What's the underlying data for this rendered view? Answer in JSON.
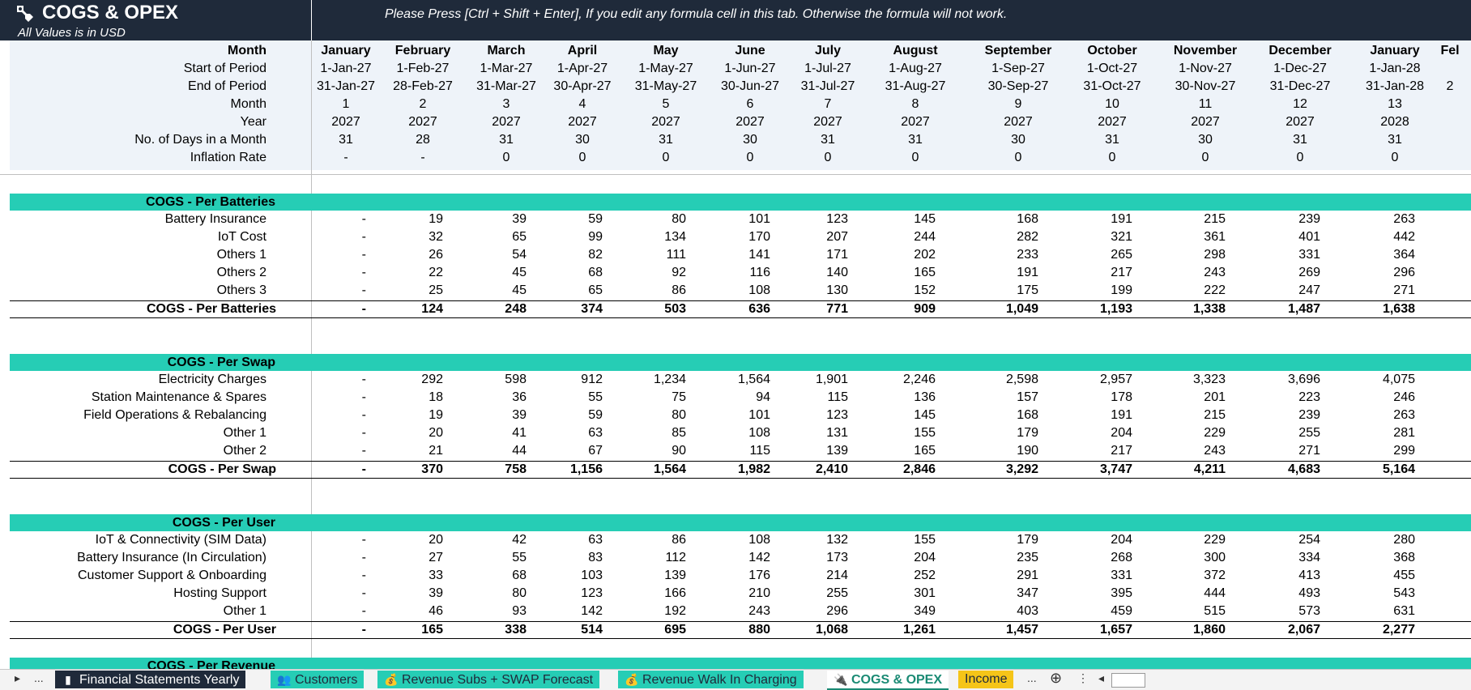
{
  "title": "COGS & OPEX",
  "subtitle": "All Values is in USD",
  "note": "Please Press [Ctrl + Shift + Enter], If you edit any formula cell in this tab. Otherwise the formula will not work.",
  "colors": {
    "dark": "#1f2a3a",
    "section": "#26cdb5",
    "header_bg": "#eef3f9"
  },
  "columns": [
    "January",
    "February",
    "March",
    "April",
    "May",
    "June",
    "July",
    "August",
    "September",
    "October",
    "November",
    "December",
    "January",
    "Fel"
  ],
  "header_rows": [
    {
      "label": "Month",
      "cells": [
        "January",
        "February",
        "March",
        "April",
        "May",
        "June",
        "July",
        "August",
        "September",
        "October",
        "November",
        "December",
        "January",
        "Fel"
      ]
    },
    {
      "label": "Start of Period",
      "cells": [
        "1-Jan-27",
        "1-Feb-27",
        "1-Mar-27",
        "1-Apr-27",
        "1-May-27",
        "1-Jun-27",
        "1-Jul-27",
        "1-Aug-27",
        "1-Sep-27",
        "1-Oct-27",
        "1-Nov-27",
        "1-Dec-27",
        "1-Jan-28",
        ""
      ]
    },
    {
      "label": "End of Period",
      "cells": [
        "31-Jan-27",
        "28-Feb-27",
        "31-Mar-27",
        "30-Apr-27",
        "31-May-27",
        "30-Jun-27",
        "31-Jul-27",
        "31-Aug-27",
        "30-Sep-27",
        "31-Oct-27",
        "30-Nov-27",
        "31-Dec-27",
        "31-Jan-28",
        "2"
      ]
    },
    {
      "label": "Month",
      "cells": [
        "1",
        "2",
        "3",
        "4",
        "5",
        "6",
        "7",
        "8",
        "9",
        "10",
        "11",
        "12",
        "13",
        ""
      ]
    },
    {
      "label": "Year",
      "cells": [
        "2027",
        "2027",
        "2027",
        "2027",
        "2027",
        "2027",
        "2027",
        "2027",
        "2027",
        "2027",
        "2027",
        "2027",
        "2028",
        ""
      ]
    },
    {
      "label": "No. of Days in a Month",
      "cells": [
        "31",
        "28",
        "31",
        "30",
        "31",
        "30",
        "31",
        "31",
        "30",
        "31",
        "30",
        "31",
        "31",
        ""
      ]
    },
    {
      "label": "Inflation Rate",
      "cells": [
        "-",
        "-",
        "0",
        "0",
        "0",
        "0",
        "0",
        "0",
        "0",
        "0",
        "0",
        "0",
        "0",
        ""
      ]
    }
  ],
  "sections": [
    {
      "name": "COGS - Per Batteries",
      "rows": [
        {
          "label": "Battery Insurance",
          "cells": [
            "-",
            "19",
            "39",
            "59",
            "80",
            "101",
            "123",
            "145",
            "168",
            "191",
            "215",
            "239",
            "263"
          ]
        },
        {
          "label": "IoT Cost",
          "cells": [
            "-",
            "32",
            "65",
            "99",
            "134",
            "170",
            "207",
            "244",
            "282",
            "321",
            "361",
            "401",
            "442"
          ]
        },
        {
          "label": "Others 1",
          "cells": [
            "-",
            "26",
            "54",
            "82",
            "111",
            "141",
            "171",
            "202",
            "233",
            "265",
            "298",
            "331",
            "364"
          ]
        },
        {
          "label": "Others 2",
          "cells": [
            "-",
            "22",
            "45",
            "68",
            "92",
            "116",
            "140",
            "165",
            "191",
            "217",
            "243",
            "269",
            "296"
          ]
        },
        {
          "label": "Others 3",
          "cells": [
            "-",
            "25",
            "45",
            "65",
            "86",
            "108",
            "130",
            "152",
            "175",
            "199",
            "222",
            "247",
            "271"
          ]
        }
      ],
      "total": {
        "label": "COGS - Per Batteries",
        "cells": [
          "-",
          "124",
          "248",
          "374",
          "503",
          "636",
          "771",
          "909",
          "1,049",
          "1,193",
          "1,338",
          "1,487",
          "1,638"
        ]
      }
    },
    {
      "name": "COGS - Per Swap",
      "rows": [
        {
          "label": "Electricity Charges",
          "cells": [
            "-",
            "292",
            "598",
            "912",
            "1,234",
            "1,564",
            "1,901",
            "2,246",
            "2,598",
            "2,957",
            "3,323",
            "3,696",
            "4,075"
          ]
        },
        {
          "label": "Station Maintenance & Spares",
          "cells": [
            "-",
            "18",
            "36",
            "55",
            "75",
            "94",
            "115",
            "136",
            "157",
            "178",
            "201",
            "223",
            "246"
          ]
        },
        {
          "label": "Field Operations & Rebalancing",
          "cells": [
            "-",
            "19",
            "39",
            "59",
            "80",
            "101",
            "123",
            "145",
            "168",
            "191",
            "215",
            "239",
            "263"
          ]
        },
        {
          "label": "Other 1",
          "cells": [
            "-",
            "20",
            "41",
            "63",
            "85",
            "108",
            "131",
            "155",
            "179",
            "204",
            "229",
            "255",
            "281"
          ]
        },
        {
          "label": "Other 2",
          "cells": [
            "-",
            "21",
            "44",
            "67",
            "90",
            "115",
            "139",
            "165",
            "190",
            "217",
            "243",
            "271",
            "299"
          ]
        }
      ],
      "total": {
        "label": "COGS - Per Swap",
        "cells": [
          "-",
          "370",
          "758",
          "1,156",
          "1,564",
          "1,982",
          "2,410",
          "2,846",
          "3,292",
          "3,747",
          "4,211",
          "4,683",
          "5,164"
        ]
      }
    },
    {
      "name": "COGS - Per User",
      "rows": [
        {
          "label": "IoT & Connectivity (SIM Data)",
          "cells": [
            "-",
            "20",
            "42",
            "63",
            "86",
            "108",
            "132",
            "155",
            "179",
            "204",
            "229",
            "254",
            "280"
          ]
        },
        {
          "label": "Battery Insurance (In Circulation)",
          "cells": [
            "-",
            "27",
            "55",
            "83",
            "112",
            "142",
            "173",
            "204",
            "235",
            "268",
            "300",
            "334",
            "368"
          ]
        },
        {
          "label": "Customer Support & Onboarding",
          "cells": [
            "-",
            "33",
            "68",
            "103",
            "139",
            "176",
            "214",
            "252",
            "291",
            "331",
            "372",
            "413",
            "455"
          ]
        },
        {
          "label": "Hosting Support",
          "cells": [
            "-",
            "39",
            "80",
            "123",
            "166",
            "210",
            "255",
            "301",
            "347",
            "395",
            "444",
            "493",
            "543"
          ]
        },
        {
          "label": "Other 1",
          "cells": [
            "-",
            "46",
            "93",
            "142",
            "192",
            "243",
            "296",
            "349",
            "403",
            "459",
            "515",
            "573",
            "631"
          ]
        }
      ],
      "total": {
        "label": "COGS - Per User",
        "cells": [
          "-",
          "165",
          "338",
          "514",
          "695",
          "880",
          "1,068",
          "1,261",
          "1,457",
          "1,657",
          "1,860",
          "2,067",
          "2,277"
        ]
      }
    },
    {
      "name": "COGS - Per Revenue",
      "rows": []
    }
  ],
  "tabs": [
    {
      "label": "Financial Statements Yearly",
      "icon": "bar-chart-icon",
      "glyph": "▮",
      "bg": "#1f2a3a",
      "fg": "#ffffff"
    },
    {
      "label": "Customers",
      "icon": "users-icon",
      "glyph": "👥",
      "bg": "#26cdb5",
      "fg": "#1f2a3a"
    },
    {
      "label": "Revenue Subs + SWAP Forecast",
      "icon": "money-bag-icon",
      "glyph": "💰",
      "bg": "#26cdb5",
      "fg": "#1f2a3a"
    },
    {
      "label": "Revenue Walk In Charging",
      "icon": "money-bag-icon",
      "glyph": "💰",
      "bg": "#26cdb5",
      "fg": "#1f2a3a"
    },
    {
      "label": "COGS & OPEX",
      "icon": "plug-icon",
      "glyph": "🔌",
      "bg": "#ffffff",
      "fg": "#1a8a74",
      "active": true
    },
    {
      "label": "Income",
      "icon": "",
      "glyph": "",
      "bg": "#f5c518",
      "fg": "#1f2a3a"
    }
  ],
  "tab_nav": {
    "prev": "▸",
    "more_left": "...",
    "more_right": "...",
    "add": "⊕",
    "options": "⋮",
    "scroll_left": "◂"
  }
}
